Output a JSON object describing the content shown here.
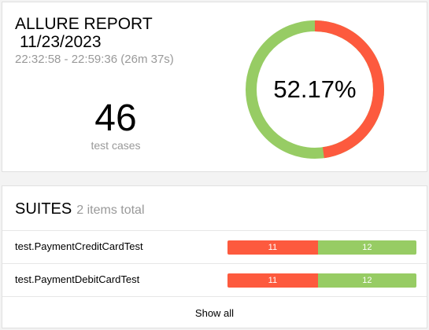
{
  "summary": {
    "title": "ALLURE REPORT",
    "date": "11/23/2023",
    "time_range": "22:32:58 - 22:59:36 (26m 37s)",
    "test_count": "46",
    "test_count_label": "test cases",
    "success_rate": "52.17%",
    "donut": {
      "passed_fraction": 0.5217,
      "failed_fraction": 0.4783,
      "passed_color": "#97cc64",
      "failed_color": "#fd5a3e"
    }
  },
  "suites": {
    "title": "SUITES",
    "total_label": "2 items total",
    "items": [
      {
        "name": "test.PaymentCreditCardTest",
        "failed": "11",
        "passed": "12"
      },
      {
        "name": "test.PaymentDebitCardTest",
        "failed": "11",
        "passed": "12"
      }
    ],
    "show_all_label": "Show all"
  }
}
